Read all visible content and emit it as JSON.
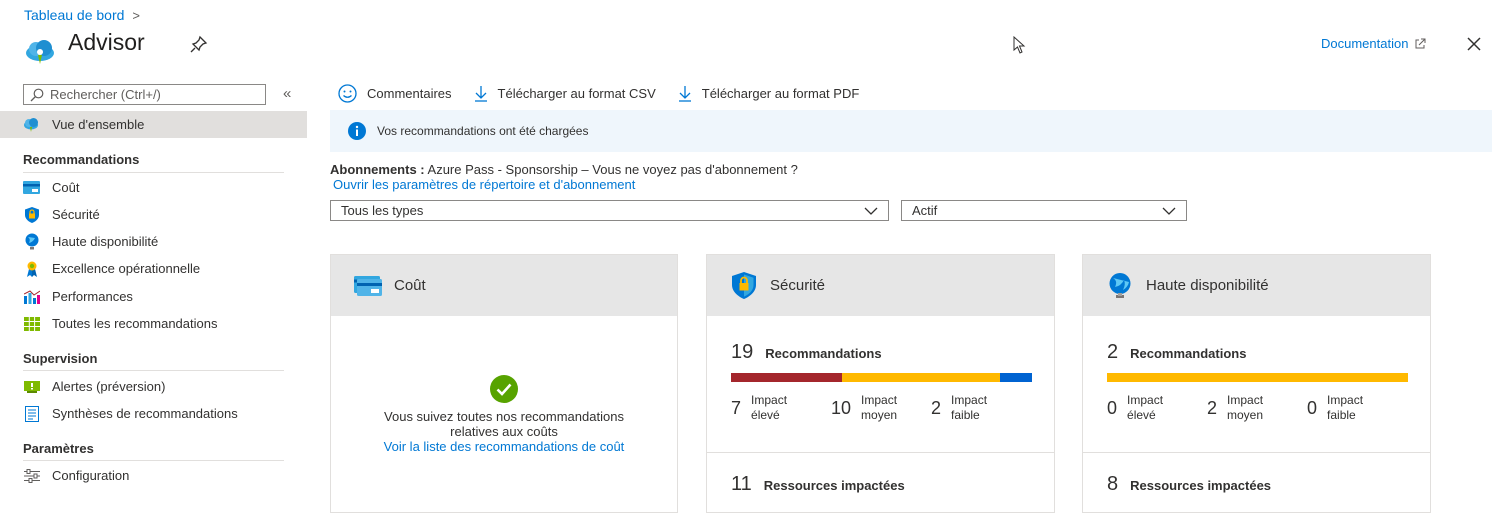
{
  "header": {
    "breadcrumb": "Tableau de bord",
    "breadcrumb_sep": ">",
    "title": "Advisor",
    "doc_link": "Documentation"
  },
  "sidebar": {
    "search_placeholder": "Rechercher (Ctrl+/)",
    "collapse": "«",
    "overview": "Vue d'ensemble",
    "sections": [
      {
        "title": "Recommandations",
        "items": [
          {
            "label": "Coût",
            "icon": "cost-card-icon"
          },
          {
            "label": "Sécurité",
            "icon": "security-shield-icon"
          },
          {
            "label": "Haute disponibilité",
            "icon": "globe-icon"
          },
          {
            "label": "Excellence opérationnelle",
            "icon": "ribbon-icon"
          },
          {
            "label": "Performances",
            "icon": "performance-chart-icon"
          },
          {
            "label": "Toutes les recommandations",
            "icon": "grid-icon"
          }
        ]
      },
      {
        "title": "Supervision",
        "items": [
          {
            "label": "Alertes (préversion)",
            "icon": "alert-icon"
          },
          {
            "label": "Synthèses de recommandations",
            "icon": "digest-icon"
          }
        ]
      },
      {
        "title": "Paramètres",
        "items": [
          {
            "label": "Configuration",
            "icon": "settings-sliders-icon"
          }
        ]
      }
    ]
  },
  "toolbar": {
    "feedback": "Commentaires",
    "csv": "Télécharger au format CSV",
    "pdf": "Télécharger au format PDF"
  },
  "info": {
    "message": "Vos recommandations ont été chargées"
  },
  "subscriptions": {
    "label": "Abonnements :",
    "value": "Azure Pass - Sponsorship – Vous ne voyez pas d'abonnement ?",
    "link": "Ouvrir les paramètres de répertoire et d'abonnement"
  },
  "filters": {
    "type_value": "Tous les types",
    "status_value": "Actif"
  },
  "cards": {
    "cost": {
      "title": "Coût",
      "message_line1": "Vous suivez toutes nos recommandations",
      "message_line2": "relatives aux coûts",
      "link": "Voir la liste des recommandations de coût"
    },
    "security": {
      "title": "Sécurité",
      "rec_count": "19",
      "rec_label": "Recommandations",
      "impacts": [
        {
          "count": "7",
          "line1": "Impact",
          "line2": "élevé"
        },
        {
          "count": "10",
          "line1": "Impact",
          "line2": "moyen"
        },
        {
          "count": "2",
          "line1": "Impact",
          "line2": "faible"
        }
      ],
      "bar": [
        {
          "value": 7,
          "color": "#a4262c"
        },
        {
          "value": 10,
          "color": "#ffb900"
        },
        {
          "value": 2,
          "color": "#0063d1"
        }
      ],
      "res_count": "11",
      "res_label": "Ressources impactées"
    },
    "ha": {
      "title": "Haute disponibilité",
      "rec_count": "2",
      "rec_label": "Recommandations",
      "impacts": [
        {
          "count": "0",
          "line1": "Impact",
          "line2": "élevé"
        },
        {
          "count": "2",
          "line1": "Impact",
          "line2": "moyen"
        },
        {
          "count": "0",
          "line1": "Impact",
          "line2": "faible"
        }
      ],
      "bar": [
        {
          "value": 0,
          "color": "#a4262c"
        },
        {
          "value": 2,
          "color": "#ffb900"
        },
        {
          "value": 0,
          "color": "#0063d1"
        }
      ],
      "res_count": "8",
      "res_label": "Ressources impactées"
    }
  }
}
